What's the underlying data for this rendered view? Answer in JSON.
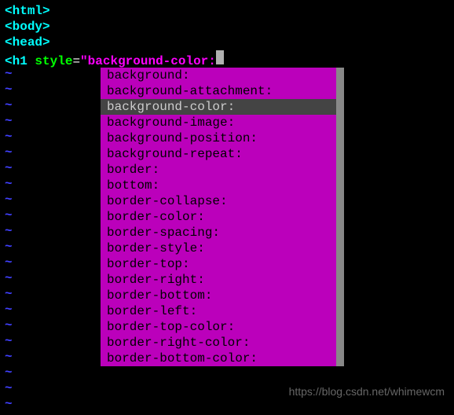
{
  "code_lines": [
    {
      "type": "tag",
      "bracket_open": "<",
      "name": "html",
      "bracket_close": ">"
    },
    {
      "type": "tag",
      "bracket_open": "<",
      "name": "body",
      "bracket_close": ">"
    },
    {
      "type": "tag",
      "bracket_open": "<",
      "name": "head",
      "bracket_close": ">"
    }
  ],
  "editing_line": {
    "bracket_open": "<",
    "tag": "h1",
    "space": " ",
    "attr": "style",
    "eq": "=",
    "quote": "\"",
    "value": "background-color:"
  },
  "tilde": "~",
  "popup_items": [
    "background:",
    "background-attachment:",
    "background-color:",
    "background-image:",
    "background-position:",
    "background-repeat:",
    "border:",
    "bottom:",
    "border-collapse:",
    "border-color:",
    "border-spacing:",
    "border-style:",
    "border-top:",
    "border-right:",
    "border-bottom:",
    "border-left:",
    "border-top-color:",
    "border-right-color:",
    "border-bottom-color:"
  ],
  "selected_index": 2,
  "watermark": "https://blog.csdn.net/whimewcm"
}
